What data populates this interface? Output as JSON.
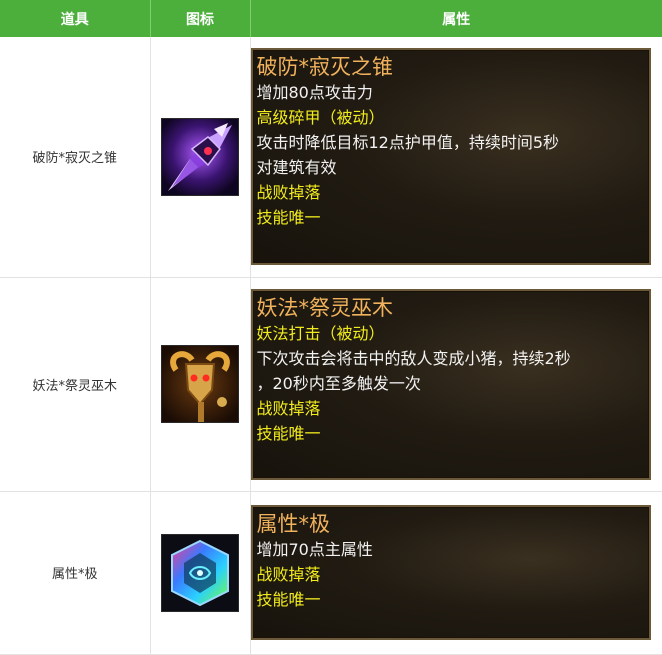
{
  "table": {
    "headers": [
      "道具",
      "图标",
      "属性"
    ],
    "rows": [
      {
        "name": "破防*寂灭之锥",
        "icon": "purple-spear-icon",
        "tooltip": {
          "title": "破防*寂灭之锥",
          "lines": [
            "增加80点攻击力",
            "高级碎甲（被动）",
            "攻击时降低目标12点护甲值，持续时间5秒",
            "对建筑有效",
            "战败掉落",
            "技能唯一"
          ]
        }
      },
      {
        "name": "妖法*祭灵巫木",
        "icon": "ram-skull-staff-icon",
        "tooltip": {
          "title": "妖法*祭灵巫木",
          "lines": [
            "妖法打击（被动）",
            "下次攻击会将击中的敌人变成小猪，持续2秒",
            "，20秒内至多触发一次",
            "战败掉落",
            "技能唯一"
          ]
        }
      },
      {
        "name": "属性*极",
        "icon": "rainbow-crystal-icon",
        "tooltip": {
          "title": "属性*极",
          "lines": [
            "增加70点主属性",
            "战败掉落",
            "技能唯一"
          ]
        }
      }
    ]
  },
  "colors": {
    "header_bg": "#4caf3c",
    "tooltip_title": "#f0b25c",
    "tooltip_text": "#f2f2f2",
    "tooltip_yellow": "#f2ec1c"
  }
}
